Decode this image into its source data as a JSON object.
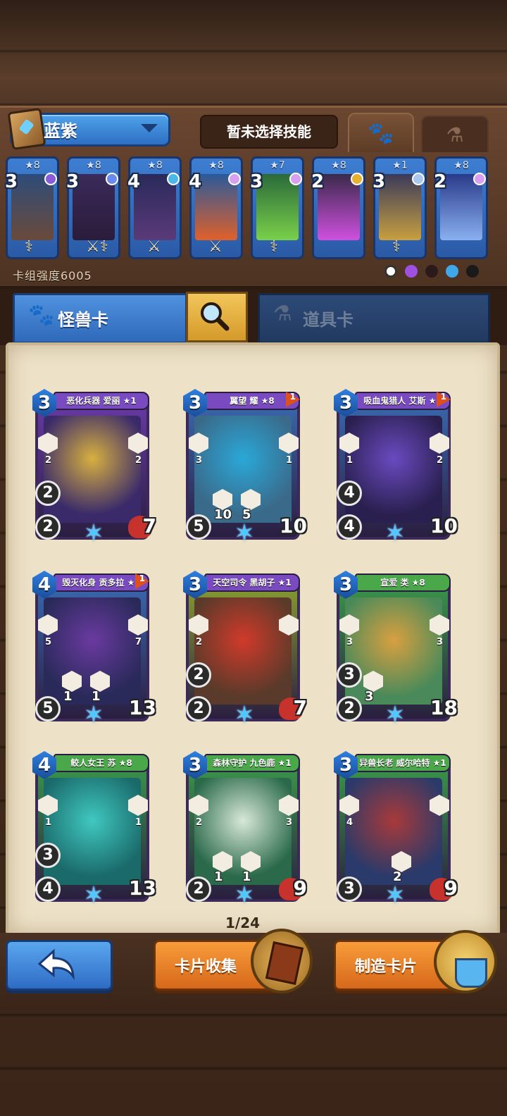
{
  "deck": {
    "name": "蓝紫",
    "skill_label": "暂未选择技能",
    "strength_label": "卡组强度6005",
    "cards": [
      {
        "cost": "3",
        "stars": "★8",
        "gem_color": "#8a5cd6",
        "art": [
          "#2d4c7a",
          "#6a4a3a"
        ],
        "weapon": "⚕"
      },
      {
        "cost": "3",
        "stars": "★8",
        "gem_color": "#6a8af0",
        "art": [
          "#3a2a5a",
          "#2a1c3a"
        ],
        "weapon": "⚔⚕"
      },
      {
        "cost": "4",
        "stars": "★8",
        "gem_color": "#4ab8e8",
        "art": [
          "#2a2a5a",
          "#5a3a7a"
        ],
        "weapon": "⚔"
      },
      {
        "cost": "4",
        "stars": "★8",
        "gem_color": "#d8a0f0",
        "art": [
          "#2a5a9a",
          "#e0602a"
        ],
        "weapon": "⚔"
      },
      {
        "cost": "3",
        "stars": "★7",
        "gem_color": "#d8a0f0",
        "art": [
          "#2a6a3a",
          "#7ad04a"
        ],
        "weapon": "⚕"
      },
      {
        "cost": "2",
        "stars": "★8",
        "gem_color": "#e8b030",
        "art": [
          "#3a2a4a",
          "#d050e0"
        ],
        "weapon": ""
      },
      {
        "cost": "3",
        "stars": "★1",
        "gem_color": "#a8c8f0",
        "art": [
          "#3a3a5a",
          "#c8a040"
        ],
        "weapon": "⚕"
      },
      {
        "cost": "2",
        "stars": "★8",
        "gem_color": "#d8a0f0",
        "art": [
          "#2a3a8a",
          "#8ab0f0"
        ],
        "weapon": ""
      }
    ]
  },
  "tabs": {
    "monster_label": "怪兽卡",
    "item_label": "道具卡"
  },
  "cards": [
    {
      "name": "恶化兵器 爱丽 ★1",
      "cost": "3",
      "theme": "#6a3aa8",
      "banner": "#7a4ac0",
      "art": [
        "#3a2a6a",
        "#d8b040"
      ],
      "atk": "2",
      "def": "2",
      "hp": "7",
      "heart": true,
      "side_left": "2",
      "side_right": "2",
      "mid": [
        "",
        ""
      ],
      "tag": ""
    },
    {
      "name": "翼望 耀 ★8",
      "cost": "3",
      "theme": "#3a6ab0",
      "banner": "#7a4ac0",
      "art": [
        "#3a6a8a",
        "#2aa8d8"
      ],
      "atk": "5",
      "def": "",
      "hp": "10",
      "heart": false,
      "side_left": "3",
      "side_right": "1",
      "mid": [
        "10",
        "5"
      ],
      "tag": "1"
    },
    {
      "name": "吸血鬼猎人 艾斯 ★8",
      "cost": "3",
      "theme": "#3a6ab0",
      "banner": "#7a4ac0",
      "art": [
        "#2a2050",
        "#6a4ac0"
      ],
      "atk": "4",
      "def": "4",
      "hp": "10",
      "heart": false,
      "side_left": "1",
      "side_right": "2",
      "mid": [
        "",
        ""
      ],
      "tag": "1"
    },
    {
      "name": "毁灭化身 贡多拉 ★8",
      "cost": "4",
      "theme": "#3a6ab0",
      "banner": "#7a4ac0",
      "art": [
        "#2a2a5a",
        "#6a3aa0"
      ],
      "atk": "5",
      "def": "",
      "hp": "13",
      "heart": false,
      "side_left": "5",
      "side_right": "7",
      "mid": [
        "1",
        "1"
      ],
      "tag": "1"
    },
    {
      "name": "天空司令 黑胡子 ★1",
      "cost": "3",
      "theme": "#8aa030",
      "banner": "#7a4ac0",
      "art": [
        "#5a3a2a",
        "#d03a2a"
      ],
      "atk": "2",
      "def": "2",
      "hp": "7",
      "heart": true,
      "side_left": "2",
      "side_right": "",
      "mid": [
        "",
        ""
      ],
      "tag": ""
    },
    {
      "name": "宣爱 类 ★8",
      "cost": "3",
      "theme": "#3a9a4a",
      "banner": "#4aa84a",
      "art": [
        "#4a8a5a",
        "#d8a040"
      ],
      "atk": "2",
      "def": "3",
      "hp": "18",
      "heart": false,
      "side_left": "3",
      "side_right": "3",
      "mid": [
        "3",
        ""
      ],
      "tag": ""
    },
    {
      "name": "鲛人女王 苏 ★8",
      "cost": "4",
      "theme": "#3a9a4a",
      "banner": "#4aa84a",
      "art": [
        "#1a6a6a",
        "#40c8c0"
      ],
      "atk": "4",
      "def": "3",
      "hp": "13",
      "heart": false,
      "side_left": "1",
      "side_right": "1",
      "mid": [
        "",
        ""
      ],
      "tag": ""
    },
    {
      "name": "森林守护 九色鹿 ★1",
      "cost": "3",
      "theme": "#3a9a4a",
      "banner": "#4aa84a",
      "art": [
        "#2a6a4a",
        "#d8e8d8"
      ],
      "atk": "2",
      "def": "",
      "hp": "9",
      "heart": true,
      "side_left": "2",
      "side_right": "3",
      "mid": [
        "1",
        "1"
      ],
      "tag": ""
    },
    {
      "name": "异兽长老 威尔哈特 ★1",
      "cost": "3",
      "theme": "#3a9a4a",
      "banner": "#4aa84a",
      "art": [
        "#2a3a6a",
        "#a83a3a"
      ],
      "atk": "3",
      "def": "",
      "hp": "9",
      "heart": true,
      "side_left": "4",
      "side_right": "",
      "mid": [
        "",
        "2"
      ],
      "tag": ""
    }
  ],
  "pager": "1/24",
  "buttons": {
    "collect_label": "卡片收集",
    "craft_label": "制造卡片"
  },
  "icons": {
    "paw": "paw-icon",
    "potion": "potion-icon",
    "search": "search-icon",
    "back": "back-arrow-icon"
  }
}
